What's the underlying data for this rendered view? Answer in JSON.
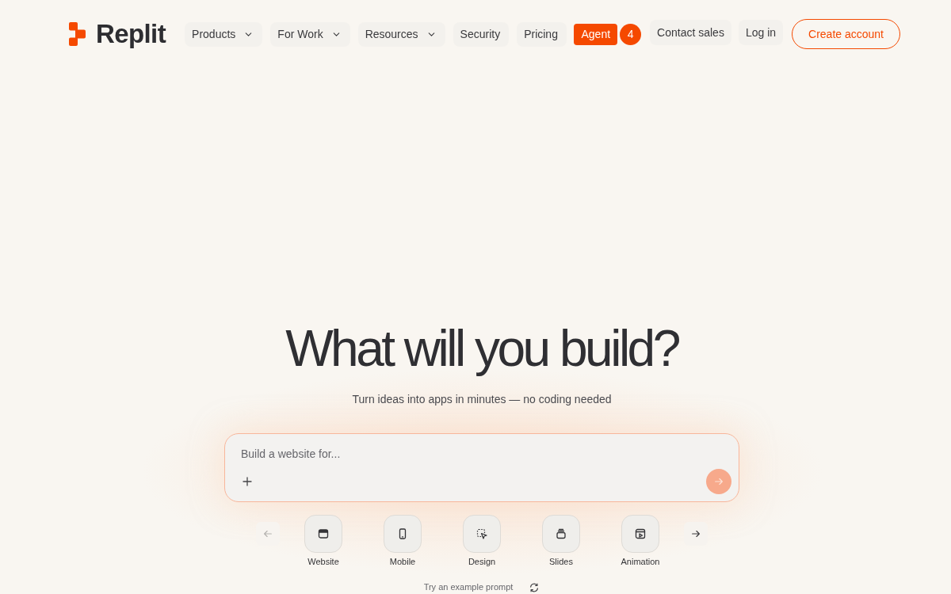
{
  "brand": {
    "name": "Replit"
  },
  "nav": {
    "items": [
      {
        "label": "Products",
        "has_menu": true
      },
      {
        "label": "For Work",
        "has_menu": true
      },
      {
        "label": "Resources",
        "has_menu": true
      },
      {
        "label": "Security",
        "has_menu": false
      },
      {
        "label": "Pricing",
        "has_menu": false
      }
    ],
    "agent": {
      "label": "Agent",
      "badge": "4"
    },
    "actions": [
      {
        "label": "Contact sales",
        "kind": "ghost"
      },
      {
        "label": "Log in",
        "kind": "ghost"
      },
      {
        "label": "Create account",
        "kind": "outline"
      }
    ]
  },
  "hero": {
    "title": "What will you build?",
    "subtitle": "Turn ideas into apps in minutes — no coding needed"
  },
  "prompt": {
    "placeholder": "Build a website for...",
    "send_disabled": true
  },
  "categories": {
    "previous_disabled": true,
    "next_disabled": false,
    "items": [
      {
        "label": "Website",
        "kind": "website"
      },
      {
        "label": "Mobile",
        "kind": "mobile"
      },
      {
        "label": "Design",
        "kind": "design"
      },
      {
        "label": "Slides",
        "kind": "slides"
      },
      {
        "label": "Animation",
        "kind": "animation"
      }
    ]
  },
  "example": {
    "label": "Try an example prompt"
  }
}
